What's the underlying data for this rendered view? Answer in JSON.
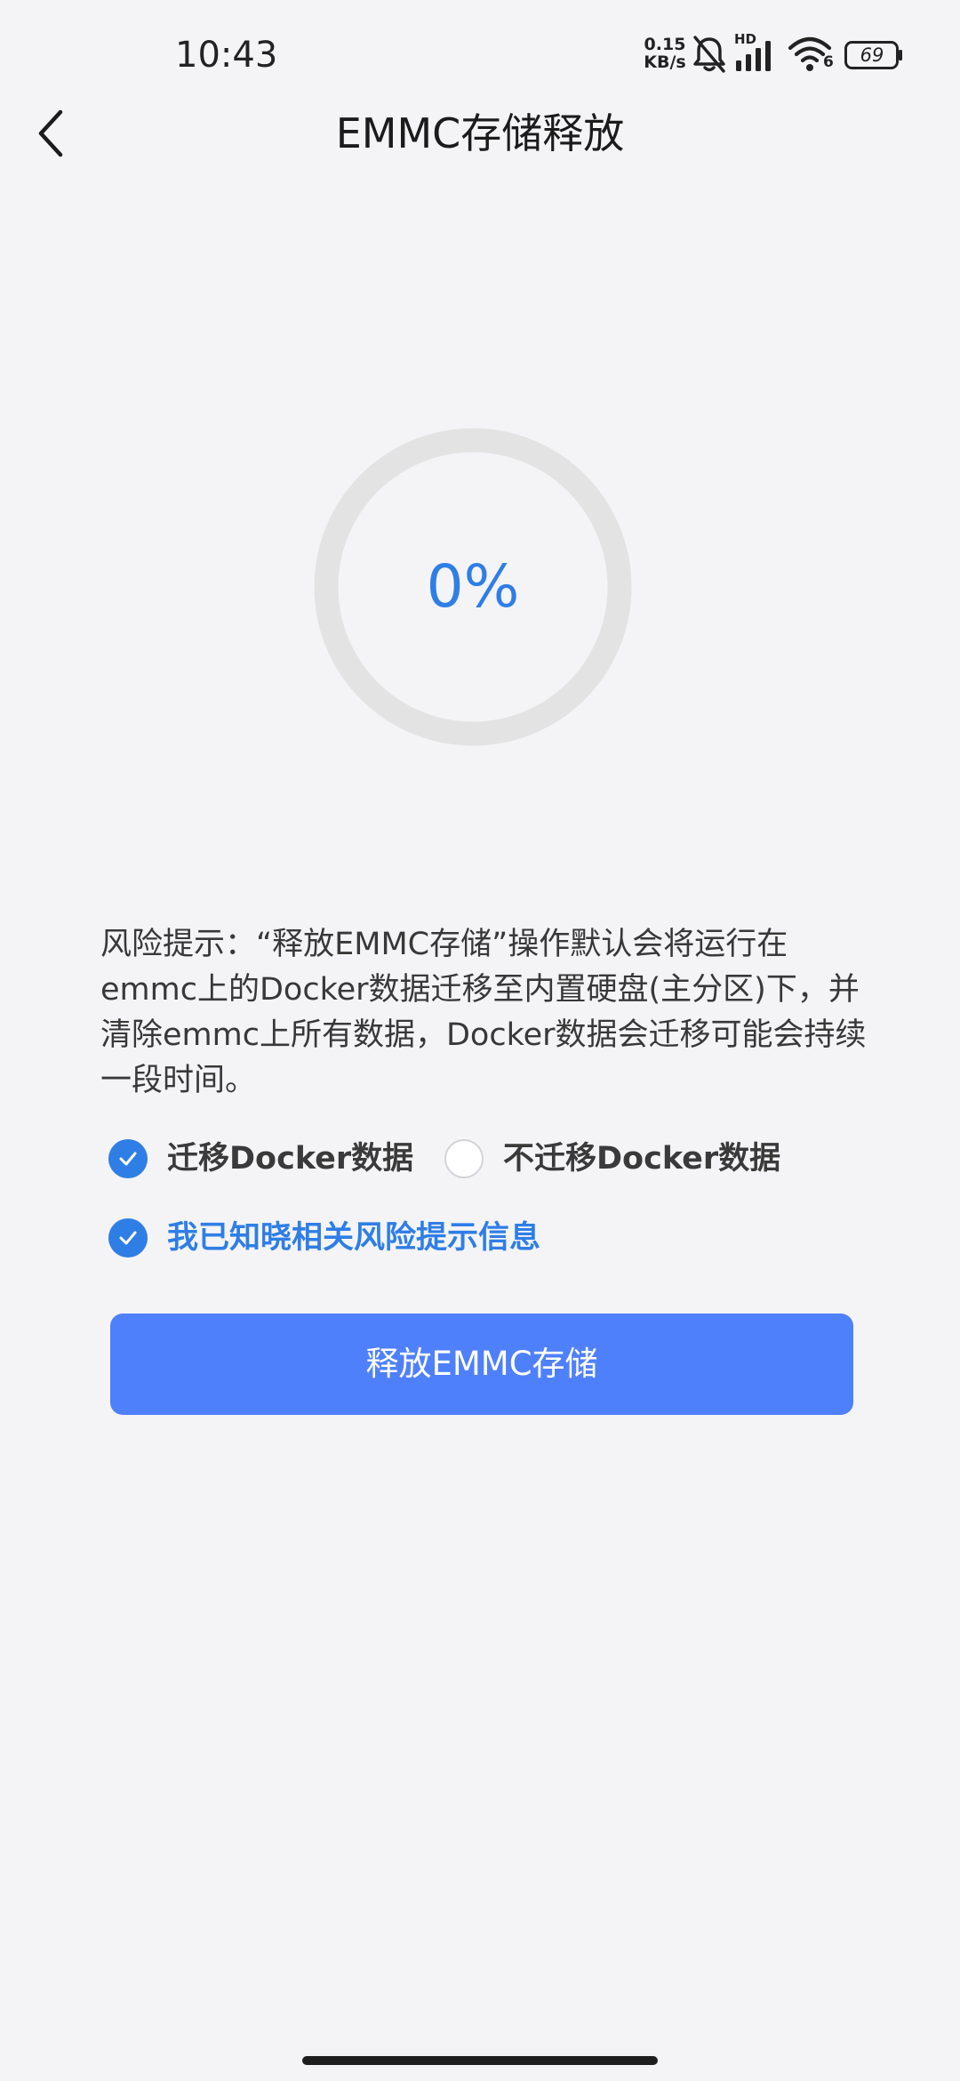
{
  "status_bar": {
    "time": "10:43",
    "network_speed_value": "0.15",
    "network_speed_unit": "KB/s",
    "signal_label": "HD",
    "wifi_label": "6",
    "battery_level": "69"
  },
  "header": {
    "title": "EMMC存储释放"
  },
  "progress": {
    "percent_text": "0%",
    "value": 0
  },
  "risk_notice": {
    "text": "风险提示：“释放EMMC存储”操作默认会将运行在emmc上的Docker数据迁移至内置硬盘(主分区)下，并清除emmc上所有数据，Docker数据会迁移可能会持续一段时间。"
  },
  "options": {
    "migrate_label": "迁移Docker数据",
    "migrate_selected": true,
    "no_migrate_label": "不迁移Docker数据",
    "no_migrate_selected": false,
    "acknowledge_label": "我已知晓相关风险提示信息",
    "acknowledge_checked": true
  },
  "actions": {
    "release_button_label": "释放EMMC存储"
  },
  "colors": {
    "accent": "#2f7ee6",
    "button": "#4f80fb",
    "background": "#f4f4f7",
    "ring_track": "#e3e3e3"
  },
  "icons": {
    "back": "back-chevron-icon",
    "mute": "bell-off-icon",
    "signal": "cellular-signal-icon",
    "wifi": "wifi-icon",
    "battery": "battery-icon",
    "check": "check-icon"
  }
}
